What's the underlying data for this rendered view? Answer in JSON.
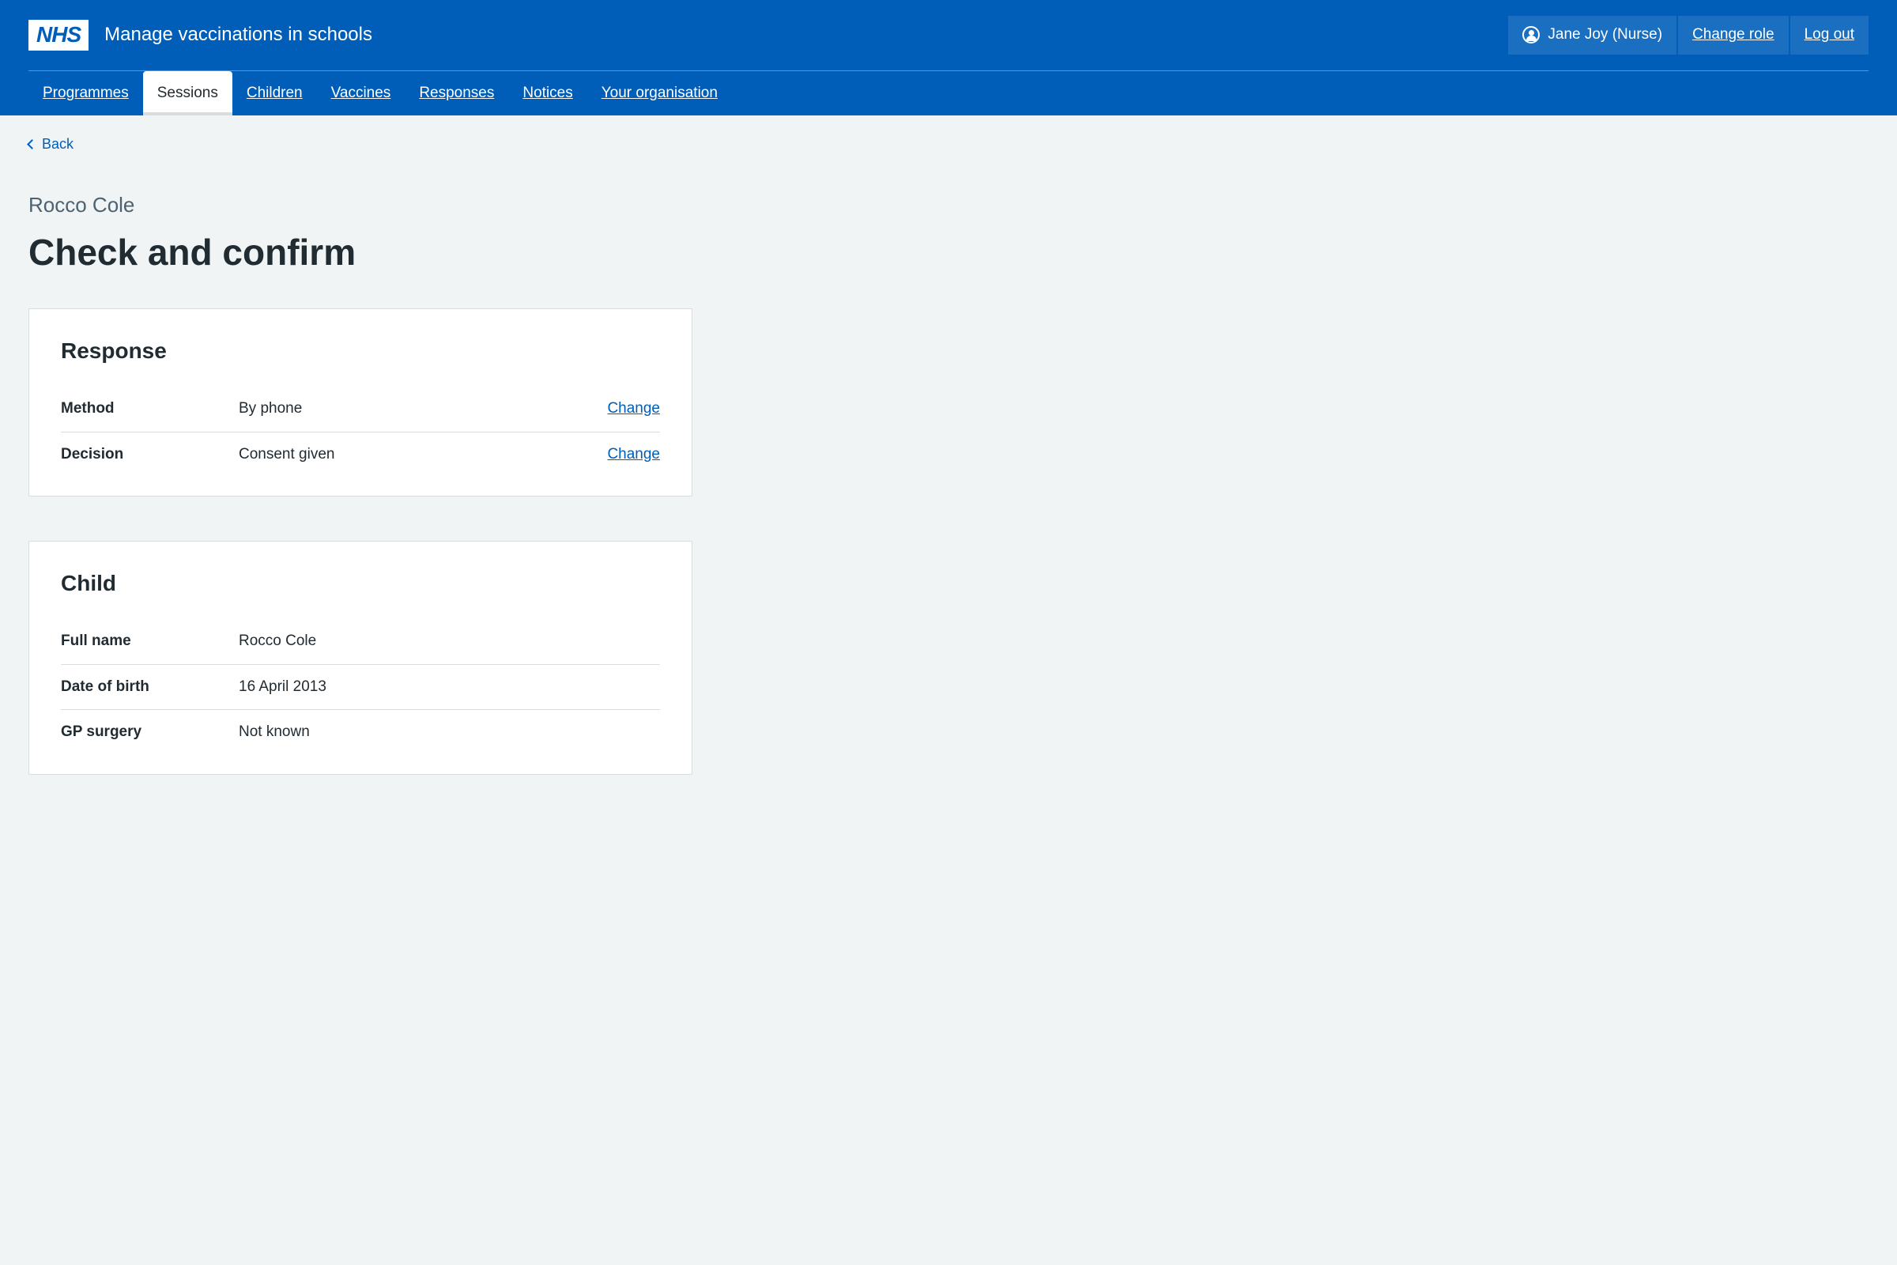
{
  "header": {
    "logo_text": "NHS",
    "service_name": "Manage vaccinations in schools",
    "user_name": "Jane Joy (Nurse)",
    "change_role": "Change role",
    "log_out": "Log out"
  },
  "nav": {
    "items": [
      {
        "label": "Programmes",
        "active": false
      },
      {
        "label": "Sessions",
        "active": true
      },
      {
        "label": "Children",
        "active": false
      },
      {
        "label": "Vaccines",
        "active": false
      },
      {
        "label": "Responses",
        "active": false
      },
      {
        "label": "Notices",
        "active": false
      },
      {
        "label": "Your organisation",
        "active": false
      }
    ]
  },
  "back_link": "Back",
  "caption": "Rocco Cole",
  "title": "Check and confirm",
  "cards": {
    "response": {
      "heading": "Response",
      "rows": [
        {
          "key": "Method",
          "value": "By phone",
          "action": "Change"
        },
        {
          "key": "Decision",
          "value": "Consent given",
          "action": "Change"
        }
      ]
    },
    "child": {
      "heading": "Child",
      "rows": [
        {
          "key": "Full name",
          "value": "Rocco Cole"
        },
        {
          "key": "Date of birth",
          "value": "16 April 2013"
        },
        {
          "key": "GP surgery",
          "value": "Not known"
        }
      ]
    }
  }
}
